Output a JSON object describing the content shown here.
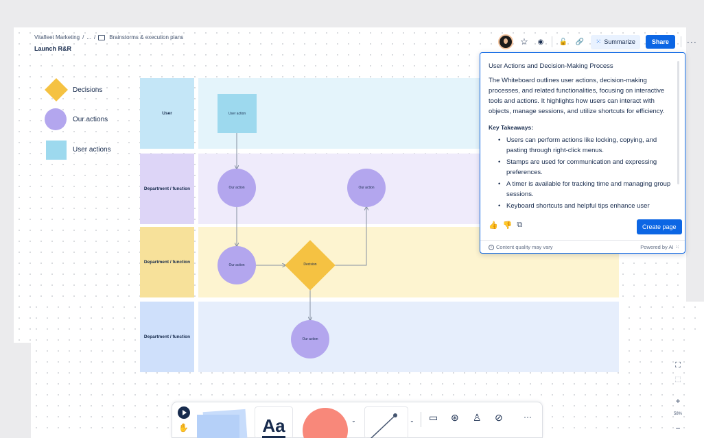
{
  "breadcrumb": {
    "space": "Vitafleet Marketing",
    "sep1": "/",
    "ellipsis": "...",
    "sep2": "/",
    "folder": "Brainstorms & execution plans"
  },
  "page_title": "Launch R&R",
  "topbar": {
    "icons": [
      "star-icon",
      "eye-icon",
      "lock-icon",
      "link-icon"
    ],
    "star": "☆",
    "watch": "◉",
    "restrict": "🔓",
    "link": "🔗",
    "summarize_label": "Summarize",
    "share_label": "Share",
    "more": "···"
  },
  "legend": {
    "decisions": "Decisions",
    "our_actions": "Our actions",
    "user_actions": "User actions"
  },
  "lanes": [
    {
      "label": "User"
    },
    {
      "label": "Department / function"
    },
    {
      "label": "Department / function"
    },
    {
      "label": "Department / function"
    }
  ],
  "nodes": {
    "user_action": "User action",
    "our_action_1": "Our action",
    "our_action_2": "Our action",
    "our_action_3": "Our action",
    "our_action_4": "Our action",
    "decision": "Decision"
  },
  "summary_panel": {
    "title": "User Actions and Decision-Making Process",
    "summary": "The Whiteboard outlines user actions, decision-making processes, and related functionalities, focusing on interactive tools and actions. It highlights how users can interact with objects, manage sessions, and utilize shortcuts for efficiency.",
    "heading": "Key Takeaways:",
    "takeaways": [
      "Users can perform actions like locking, copying, and pasting through right-click menus.",
      "Stamps are used for communication and expressing preferences.",
      "A timer is available for tracking time and managing group sessions.",
      "Keyboard shortcuts and helpful tips enhance user"
    ],
    "create_page_label": "Create page",
    "quality_note": "Content quality may vary",
    "powered_by": "Powered by AI"
  },
  "toolbar": {
    "text_tool": "Aa",
    "more": "···"
  },
  "zoom": {
    "plus": "+",
    "level": "58%",
    "minus": "−"
  },
  "colors": {
    "accent": "#0c66e4",
    "decision": "#f5c242",
    "our_action": "#b3a6ee",
    "user_action": "#9dd9ee"
  }
}
